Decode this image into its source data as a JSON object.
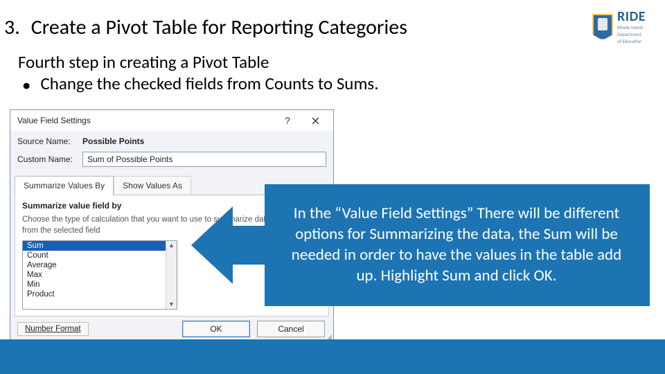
{
  "header": {
    "number": "3.",
    "title": "Create a Pivot Table for Reporting Categories"
  },
  "logo": {
    "name": "RIDE",
    "line1": "Rhode Island",
    "line2": "Department",
    "line3": "of Education"
  },
  "body": {
    "step_line": "Fourth step in creating a Pivot Table",
    "bullet_dot": "•",
    "bullet_text": "Change the checked fields from Counts to Sums."
  },
  "dialog": {
    "title": "Value Field Settings",
    "help": "?",
    "source_label": "Source Name:",
    "source_value": "Possible Points",
    "custom_label": "Custom Name:",
    "custom_value": "Sum of Possible Points",
    "tabs": {
      "summarize": "Summarize Values By",
      "showas": "Show Values As"
    },
    "panel": {
      "heading": "Summarize value field by",
      "description": "Choose the type of calculation that you want to use to summarize data from the selected field",
      "options": [
        "Sum",
        "Count",
        "Average",
        "Max",
        "Min",
        "Product"
      ]
    },
    "number_format": "Number Format",
    "ok": "OK",
    "cancel": "Cancel"
  },
  "callout": {
    "text": "In the “Value Field Settings” There will be different options for Summarizing the data, the Sum will be needed in order to have the values in the table add up. Highlight Sum and click OK."
  }
}
